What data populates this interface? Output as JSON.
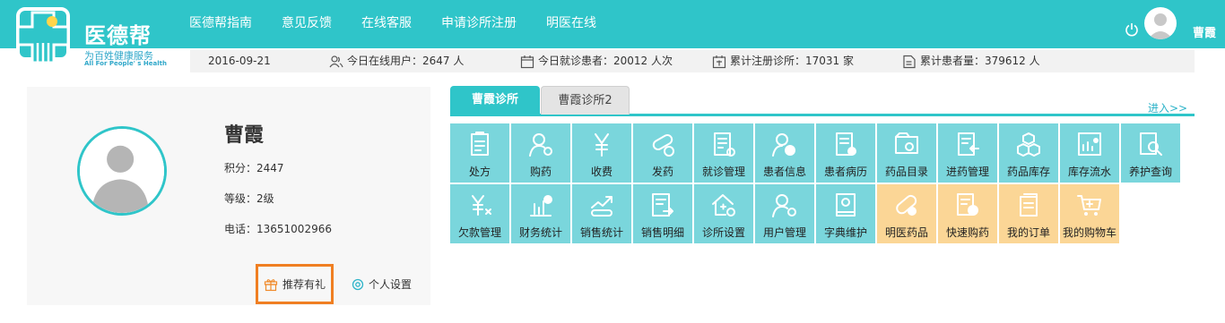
{
  "brand": {
    "title": "医德帮",
    "subtitle": "为百姓健康服务",
    "tagline_en": "All For People' s Health"
  },
  "nav": [
    "医德帮指南",
    "意见反馈",
    "在线客服",
    "申请诊所注册",
    "明医在线"
  ],
  "user": {
    "name": "曹霞"
  },
  "stats": {
    "date": "2016-09-21",
    "online_users": "今日在线用户：2647 人",
    "patients_today": "今日就诊患者：20012 人次",
    "clinics_total": "累计注册诊所：17031 家",
    "patients_total": "累计患者量：379612 人"
  },
  "profile": {
    "name": "曹霞",
    "points": "积分：2447",
    "level": "等级：2级",
    "phone": "电话：13651002966",
    "gift_label": "推荐有礼",
    "settings_label": "个人设置"
  },
  "tabs": [
    "曹霞诊所",
    "曹霞诊所2"
  ],
  "enter_link": "进入>>",
  "colors": {
    "teal": "#2fc5c9",
    "tile_teal": "#7ad6dc",
    "tile_orange": "#fbd696",
    "highlight": "#f07f22"
  },
  "tiles": [
    {
      "label": "处方",
      "icon": "prescription-icon",
      "color": "teal"
    },
    {
      "label": "购药",
      "icon": "buy-medicine-icon",
      "color": "teal"
    },
    {
      "label": "收费",
      "icon": "yen-icon",
      "color": "teal"
    },
    {
      "label": "发药",
      "icon": "pill-icon",
      "color": "teal"
    },
    {
      "label": "就诊管理",
      "icon": "visit-management-icon",
      "color": "teal"
    },
    {
      "label": "患者信息",
      "icon": "patient-info-icon",
      "color": "teal"
    },
    {
      "label": "患者病历",
      "icon": "medical-record-icon",
      "color": "teal"
    },
    {
      "label": "药品目录",
      "icon": "drug-catalog-icon",
      "color": "teal"
    },
    {
      "label": "进药管理",
      "icon": "stock-in-icon",
      "color": "teal"
    },
    {
      "label": "药品库存",
      "icon": "inventory-cubes-icon",
      "color": "teal"
    },
    {
      "label": "库存流水",
      "icon": "stock-flow-icon",
      "color": "teal"
    },
    {
      "label": "养护查询",
      "icon": "maintenance-search-icon",
      "color": "teal"
    },
    {
      "label": "欠款管理",
      "icon": "debt-icon",
      "color": "teal"
    },
    {
      "label": "财务统计",
      "icon": "finance-stats-icon",
      "color": "teal"
    },
    {
      "label": "销售统计",
      "icon": "sales-stats-icon",
      "color": "teal"
    },
    {
      "label": "销售明细",
      "icon": "sales-detail-icon",
      "color": "teal"
    },
    {
      "label": "诊所设置",
      "icon": "clinic-settings-icon",
      "color": "teal"
    },
    {
      "label": "用户管理",
      "icon": "user-management-icon",
      "color": "teal"
    },
    {
      "label": "字典维护",
      "icon": "dictionary-icon",
      "color": "teal"
    },
    {
      "label": "明医药品",
      "icon": "mingyi-drug-icon",
      "color": "orange"
    },
    {
      "label": "快速购药",
      "icon": "quick-buy-icon",
      "color": "orange"
    },
    {
      "label": "我的订单",
      "icon": "orders-icon",
      "color": "orange"
    },
    {
      "label": "我的购物车",
      "icon": "cart-icon",
      "color": "orange"
    }
  ]
}
